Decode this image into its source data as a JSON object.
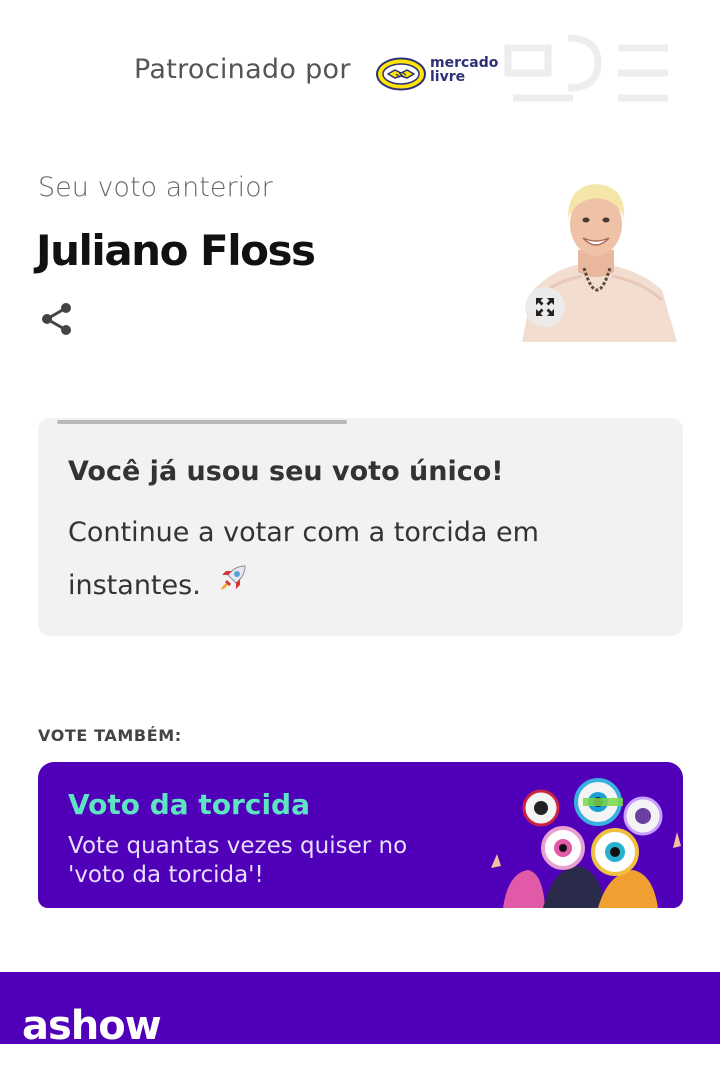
{
  "sponsor": {
    "label": "Patrocinado por",
    "brand_line1": "mercado",
    "brand_line2": "livre",
    "brand_colors": {
      "yellow": "#ffe600",
      "navy": "#2d3277"
    }
  },
  "previous_vote": {
    "label": "Seu voto anterior",
    "name": "Juliano Floss",
    "share_icon": "share-icon",
    "expand_icon": "expand-icon"
  },
  "notice": {
    "title": "Você já usou seu voto único!",
    "body": "Continue a votar com a torcida em instantes.",
    "emoji": "🚀"
  },
  "vote_also": {
    "label": "VOTE TAMBÉM:",
    "card": {
      "title": "Voto da torcida",
      "subtitle": "Vote quantas vezes quiser no 'voto da torcida'!"
    }
  },
  "footer": {
    "brand": "ashow",
    "color": "#5000b9"
  },
  "colors": {
    "accent_purple": "#5000b9",
    "accent_mint": "#5ee3c3",
    "card_bg": "#f2f2f2"
  }
}
